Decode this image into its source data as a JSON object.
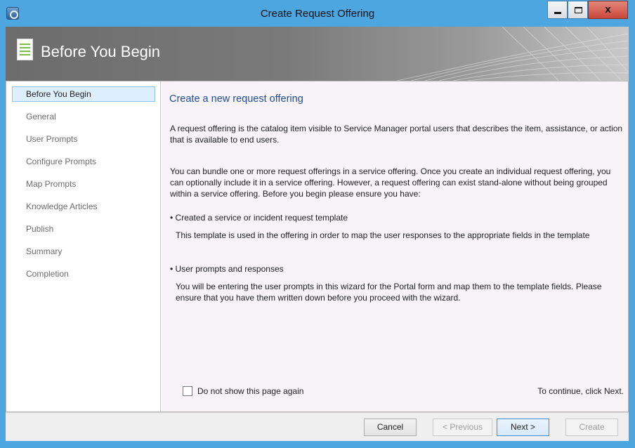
{
  "window": {
    "title": "Create Request Offering",
    "controls": {
      "minimize": "minimize",
      "maximize": "maximize",
      "close": "x"
    }
  },
  "header": {
    "title": "Before You Begin"
  },
  "nav": {
    "items": [
      {
        "label": "Before You Begin",
        "active": true
      },
      {
        "label": "General",
        "active": false
      },
      {
        "label": "User Prompts",
        "active": false
      },
      {
        "label": "Configure Prompts",
        "active": false
      },
      {
        "label": "Map Prompts",
        "active": false
      },
      {
        "label": "Knowledge Articles",
        "active": false
      },
      {
        "label": "Publish",
        "active": false
      },
      {
        "label": "Summary",
        "active": false
      },
      {
        "label": "Completion",
        "active": false
      }
    ]
  },
  "main": {
    "title": "Create a new request offering",
    "para1": "A request offering is the catalog item visible to Service Manager portal users that describes the item, assistance, or action that is available to end users.",
    "para2": "You can bundle one or more request offerings in a service offering. Once you create an individual request offering, you can optionally include it in a service offering. However, a request offering can exist stand-alone without being grouped within a service offering.  Before you begin please ensure you have:",
    "bullets": [
      {
        "title": "Created a service or incident request template",
        "desc": "This template is used in the offering in order to map the user responses to the appropriate fields in the template"
      },
      {
        "title": "User prompts and responses",
        "desc": "You will be entering the user prompts in this wizard for the Portal form and map them to the template fields. Please ensure that you have them written down before you proceed with the wizard."
      }
    ],
    "checkbox_label": "Do not show this page again",
    "checkbox_checked": false,
    "hint": "To continue, click Next."
  },
  "footer": {
    "cancel": "Cancel",
    "previous": "< Previous",
    "next": "Next >",
    "create": "Create"
  },
  "colors": {
    "titlebar": "#4da6df",
    "header": "#7a7a7a",
    "accent_title": "#1f4c98",
    "nav_active_bg": "#ddeefc",
    "close_button": "#c9473a"
  }
}
